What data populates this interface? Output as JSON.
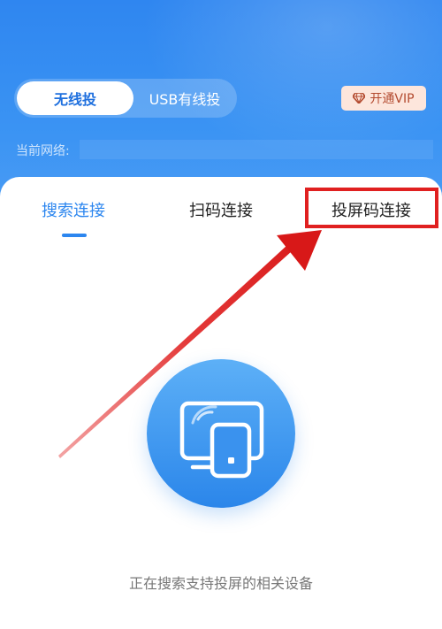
{
  "mode_switch": {
    "wireless_label": "无线投",
    "usb_label": "USB有线投"
  },
  "vip": {
    "label": "开通VIP",
    "icon": "diamond-icon"
  },
  "network": {
    "label": "当前网络:",
    "value": ""
  },
  "tabs": [
    {
      "label": "搜索连接",
      "active": true
    },
    {
      "label": "扫码连接",
      "active": false
    },
    {
      "label": "投屏码连接",
      "active": false
    }
  ],
  "main": {
    "icon": "screen-cast-icon",
    "status": "正在搜索支持投屏的相关设备"
  },
  "colors": {
    "header_blue": "#2f86f0",
    "accent_blue": "#2c86ef",
    "annotation_red": "#e02020",
    "vip_bg": "#fde6dc"
  }
}
